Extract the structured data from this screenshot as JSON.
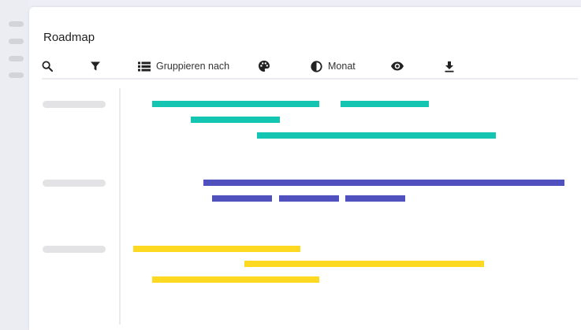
{
  "window": {
    "title": "Roadmap"
  },
  "toolbar": {
    "items": [
      {
        "id": "search",
        "icon": "search-icon",
        "label": ""
      },
      {
        "id": "filter",
        "icon": "filter-icon",
        "label": ""
      },
      {
        "id": "group",
        "icon": "list-icon",
        "label": "Gruppieren nach"
      },
      {
        "id": "color",
        "icon": "palette-icon",
        "label": ""
      },
      {
        "id": "month",
        "icon": "half-circle-icon",
        "label": "Monat"
      },
      {
        "id": "view",
        "icon": "eye-icon",
        "label": ""
      },
      {
        "id": "download",
        "icon": "download-icon",
        "label": ""
      }
    ]
  },
  "colors": {
    "teal": "#14c5b1",
    "indigo": "#5050bf",
    "yellow": "#fdd922",
    "page_bg": "#eeeef6",
    "card_bg": "#ffffff",
    "placeholder": "#e3e3e6"
  },
  "groups": [
    {
      "color": "teal",
      "bars": 4
    },
    {
      "color": "indigo",
      "bars": 4
    },
    {
      "color": "yellow",
      "bars": 3
    }
  ]
}
